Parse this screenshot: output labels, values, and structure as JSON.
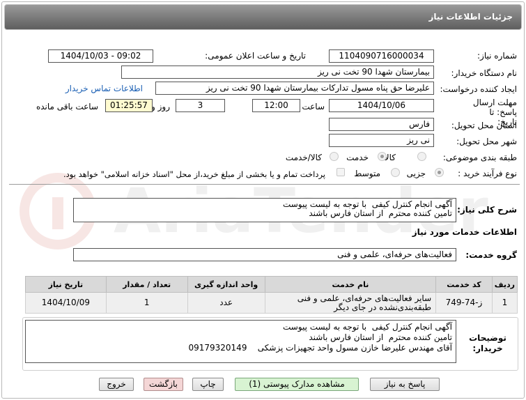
{
  "window": {
    "title": "جزئیات اطلاعات نیاز"
  },
  "header": {
    "need_number_label": "شماره نیاز:",
    "need_number": "1104090716000034",
    "announce_label": "تاریخ و ساعت اعلان عمومی:",
    "announce_value": "1404/10/03 - 09:02",
    "buyer_label": "نام دستگاه خریدار:",
    "buyer_value": "بیمارستان شهدا 90 تخت نی ریز",
    "creator_label": "ایجاد کننده درخواست:",
    "creator_value": "علیرضا حق پناه مسول تدارکات بیمارستان شهدا 90 تخت نی ریز",
    "contact_link": "اطلاعات تماس خریدار",
    "deadline_label": "مهلت ارسال پاسخ: تا تاریخ:",
    "deadline_date": "1404/10/06",
    "time_label": "ساعت",
    "deadline_time": "12:00",
    "days_value": "3",
    "days_label": "روز و",
    "remaining_time": "01:25:57",
    "remaining_label": "ساعت باقی مانده",
    "province_label": "استان محل تحویل:",
    "province_value": "فارس",
    "city_label": "شهر محل تحویل:",
    "city_value": "نی ریز",
    "category_label": "طبقه بندی موضوعی:",
    "category_options": [
      "کالا",
      "خدمت",
      "کالا/خدمت"
    ],
    "category_selected": "خدمت",
    "process_label": "نوع فرآیند خرید :",
    "process_options": [
      "جزیی",
      "متوسط"
    ],
    "process_selected": "جزیی",
    "payment_note": "پرداخت تمام و یا بخشی از مبلغ خرید،از محل \"اسناد خزانه اسلامی\" خواهد بود."
  },
  "description": {
    "label": "شرح کلی نیاز:",
    "text": "آگهی انجام کنترل کیفی  با توجه به لیست پیوست\nتامین کننده محترم  از استان فارس باشند"
  },
  "services": {
    "section_title": "اطلاعات خدمات مورد نیاز",
    "group_label": "گروه خدمت:",
    "group_value": "فعالیت‌های حرفه‌ای، علمی و فنی",
    "columns": [
      "ردیف",
      "کد خدمت",
      "نام خدمت",
      "واحد اندازه گیری",
      "تعداد / مقدار",
      "تاریخ نیاز"
    ],
    "rows": [
      {
        "row": "1",
        "code": "ز-74-749",
        "name": "سایر فعالیت‌های حرفه‌ای، علمی و فنی طبقه‌بندی‌نشده در جای دیگر",
        "unit": "عدد",
        "qty": "1",
        "date": "1404/10/09"
      }
    ]
  },
  "buyer_notes": {
    "label": "توضیحات خریدار:",
    "text": "آگهی انجام کنترل کیفی  با توجه به لیست پیوست\nتامین کننده محترم  از استان فارس باشند\nآقای مهندس علیرضا خازن مسول واحد تجهیزات پزشکی    09179320149"
  },
  "buttons": {
    "reply": "پاسخ به نیاز",
    "view_docs": "مشاهده مدارک پیوستی (1)",
    "print": "چاپ",
    "back": "بازگشت",
    "exit": "خروج"
  },
  "colors": {
    "title_bar": "#6f6f6f",
    "remaining_bg": "#fffbd0",
    "link": "#1a5fb4",
    "docs_button": "#d8f3d2",
    "back_button": "#f4d6d6"
  }
}
